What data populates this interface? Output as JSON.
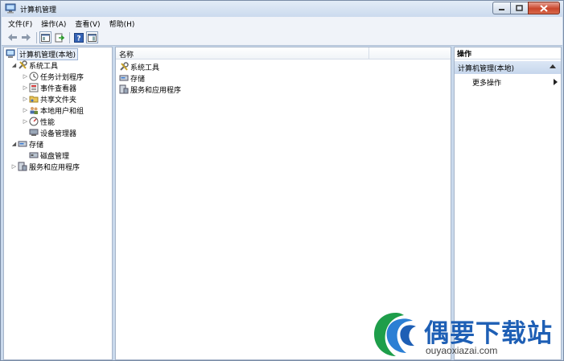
{
  "window": {
    "title": "计算机管理"
  },
  "menubar": {
    "items": [
      "文件(F)",
      "操作(A)",
      "查看(V)",
      "帮助(H)"
    ]
  },
  "tree": {
    "items": [
      {
        "label": "计算机管理(本地)",
        "icon": "computer-management-icon"
      },
      {
        "label": "系统工具",
        "icon": "tools-icon"
      },
      {
        "label": "任务计划程序",
        "icon": "clock-icon"
      },
      {
        "label": "事件查看器",
        "icon": "event-viewer-icon"
      },
      {
        "label": "共享文件夹",
        "icon": "shared-folder-icon"
      },
      {
        "label": "本地用户和组",
        "icon": "users-icon"
      },
      {
        "label": "性能",
        "icon": "performance-icon"
      },
      {
        "label": "设备管理器",
        "icon": "device-manager-icon"
      },
      {
        "label": "存储",
        "icon": "storage-icon"
      },
      {
        "label": "磁盘管理",
        "icon": "disk-icon"
      },
      {
        "label": "服务和应用程序",
        "icon": "services-icon"
      }
    ]
  },
  "list": {
    "column_name": "名称",
    "items": [
      {
        "label": "系统工具",
        "icon": "tools-icon"
      },
      {
        "label": "存储",
        "icon": "storage-icon"
      },
      {
        "label": "服务和应用程序",
        "icon": "services-icon"
      }
    ]
  },
  "actions": {
    "title": "操作",
    "group": "计算机管理(本地)",
    "more": "更多操作"
  },
  "watermark": {
    "brand": "偶要下载站",
    "url": "ouyaoxiazai.com"
  },
  "colors": {
    "accent": "#1e5fb5",
    "selection": "#e6eef9",
    "group_header": "#c6d6ec"
  }
}
